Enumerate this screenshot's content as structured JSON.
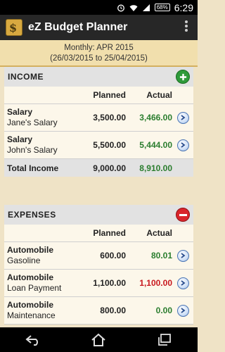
{
  "status": {
    "battery": "68%",
    "time": "6:29"
  },
  "app": {
    "title": "eZ Budget Planner",
    "icon_letter": "$"
  },
  "period": {
    "line1": "Monthly: APR 2015",
    "line2": "(26/03/2015 to 25/04/2015)"
  },
  "columns": {
    "planned": "Planned",
    "actual": "Actual"
  },
  "income": {
    "title": "INCOME",
    "rows": [
      {
        "category": "Salary",
        "name": "Jane's Salary",
        "planned": "3,500.00",
        "actual": "3,466.00"
      },
      {
        "category": "Salary",
        "name": "John's Salary",
        "planned": "5,500.00",
        "actual": "5,444.00"
      }
    ],
    "total": {
      "label": "Total Income",
      "planned": "9,000.00",
      "actual": "8,910.00"
    }
  },
  "expenses": {
    "title": "EXPENSES",
    "rows": [
      {
        "category": "Automobile",
        "name": "Gasoline",
        "planned": "600.00",
        "actual": "80.01"
      },
      {
        "category": "Automobile",
        "name": "Loan Payment",
        "planned": "1,100.00",
        "actual": "1,100.00"
      },
      {
        "category": "Automobile",
        "name": "Maintenance",
        "planned": "800.00",
        "actual": "0.00"
      }
    ]
  },
  "colors": {
    "add": "#2e9a3a",
    "remove": "#d9252b",
    "actual_ok": "#2a7d2e",
    "actual_over": "#c8181e"
  },
  "icons": [
    "wifi-icon",
    "signal-icon",
    "battery-icon",
    "overflow-menu-icon",
    "add-icon",
    "remove-icon",
    "arrow-right-icon",
    "back-icon",
    "home-icon",
    "recents-icon"
  ]
}
